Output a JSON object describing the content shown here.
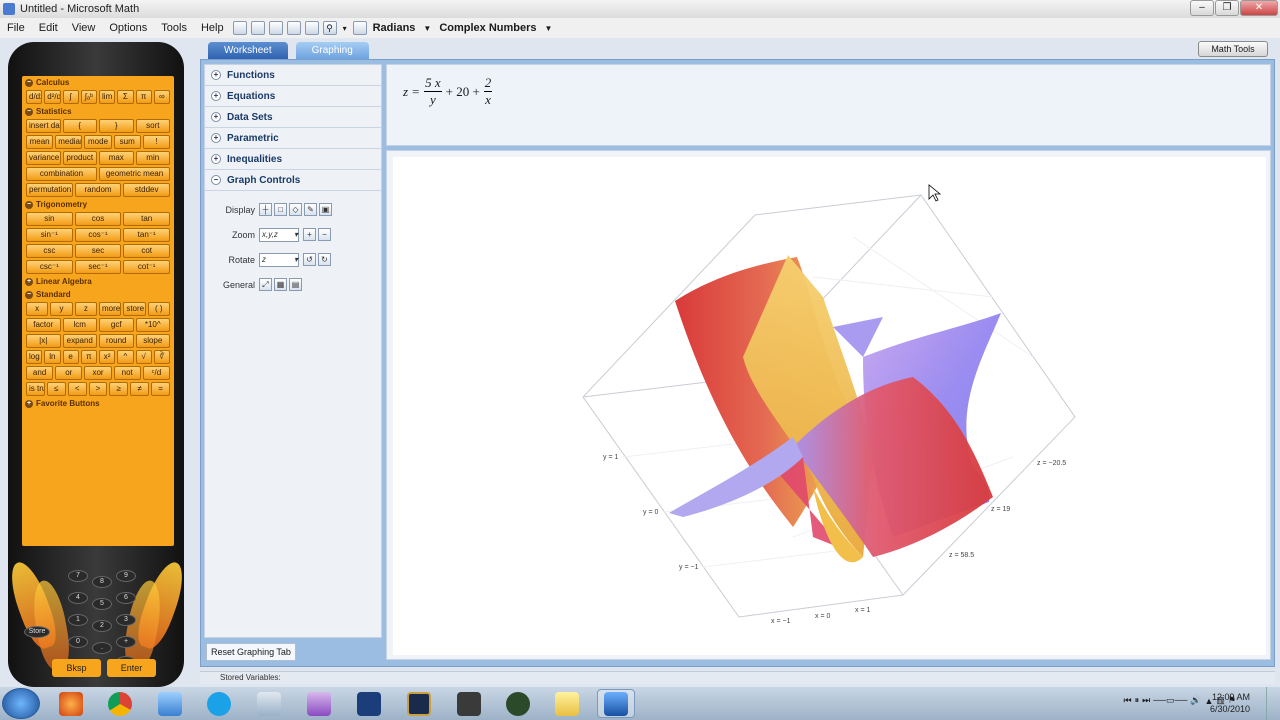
{
  "window": {
    "title": "Untitled - Microsoft Math"
  },
  "menu": {
    "items": [
      "File",
      "Edit",
      "View",
      "Options",
      "Tools",
      "Help"
    ]
  },
  "toolbar": {
    "angle_mode": "Radians",
    "number_mode": "Complex Numbers"
  },
  "math_tools_button": "Math Tools",
  "calculator": {
    "sections": {
      "calculus": "Calculus",
      "statistics": "Statistics",
      "trigonometry": "Trigonometry",
      "linear_algebra": "Linear Algebra",
      "standard": "Standard",
      "favorite": "Favorite Buttons"
    },
    "calculus_row": [
      "d/dx",
      "d²/dx²",
      "∫",
      "∫ₐᵇ",
      "lim",
      "Σ",
      "π",
      "∞"
    ],
    "stats_rows": [
      [
        "insert data set",
        "{",
        "}",
        "sort"
      ],
      [
        "mean",
        "median",
        "mode",
        "sum",
        "!"
      ],
      [
        "variance",
        "product",
        "max",
        "min"
      ],
      [
        "combination",
        "geometric mean"
      ],
      [
        "permutation",
        "random",
        "stddev"
      ]
    ],
    "trig_rows": [
      [
        "sin",
        "cos",
        "tan"
      ],
      [
        "sin⁻¹",
        "cos⁻¹",
        "tan⁻¹"
      ],
      [
        "csc",
        "sec",
        "cot"
      ],
      [
        "csc⁻¹",
        "sec⁻¹",
        "cot⁻¹"
      ]
    ],
    "standard_rows": [
      [
        "x",
        "y",
        "z",
        "more vars",
        "store",
        "( )"
      ],
      [
        "factor",
        "lcm",
        "gcf",
        "*10^"
      ],
      [
        "|x|",
        "expand",
        "round",
        "slope"
      ],
      [
        "log",
        "ln",
        "e",
        "π",
        "x²",
        "^",
        "√",
        "∛"
      ],
      [
        "and",
        "or",
        "xor",
        "not",
        "ᶜ/d"
      ],
      [
        "is true",
        "≤",
        "<",
        ">",
        "≥",
        "≠",
        "="
      ]
    ],
    "keypad": [
      "7",
      "8",
      "9",
      "4",
      "5",
      "6",
      "1",
      "2",
      "3",
      "0",
      ".",
      "+",
      "−",
      "Store"
    ],
    "bksp": "Bksp",
    "enter": "Enter"
  },
  "tabs": [
    "Worksheet",
    "Graphing"
  ],
  "panel": {
    "items": [
      "Functions",
      "Equations",
      "Data Sets",
      "Parametric",
      "Inequalities",
      "Graph Controls"
    ],
    "display_label": "Display",
    "zoom_label": "Zoom",
    "zoom_value": "x,y,z",
    "rotate_label": "Rotate",
    "rotate_value": "z",
    "general_label": "General",
    "reset": "Reset Graphing Tab"
  },
  "equation": {
    "lhs": "z =",
    "num1": "5 x",
    "den1": "y",
    "mid": "+ 20 +",
    "num2": "2",
    "den2": "x"
  },
  "graph": {
    "axis_labels": [
      "y = 1",
      "y = 0",
      "y = −1",
      "x = −1",
      "x = 0",
      "x = 1",
      "z = −20.5",
      "z = 19",
      "z = 58.5"
    ]
  },
  "stored_variables": "Stored Variables:",
  "clock": {
    "time": "12:09 AM",
    "date": "6/30/2010"
  }
}
